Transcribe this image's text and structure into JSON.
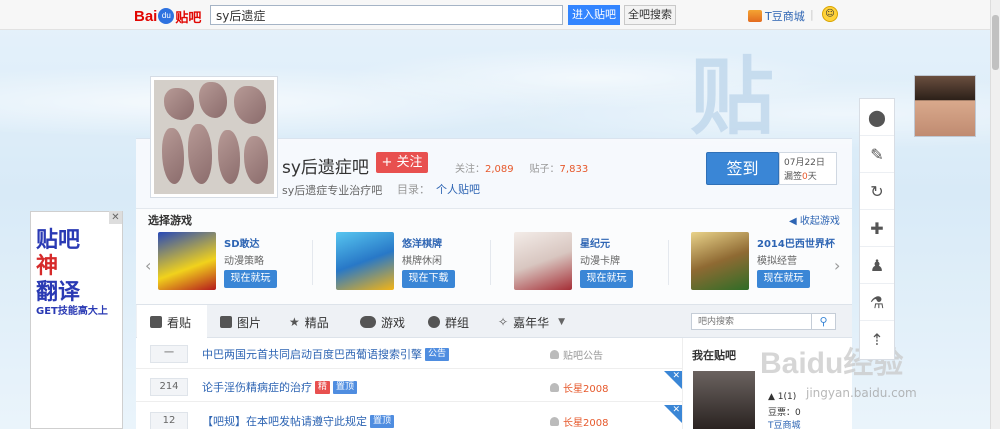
{
  "topbar": {
    "logo_bai": "Bai",
    "logo_du": "du",
    "logo_tieba": "贴吧",
    "search_value": "sy后遗症",
    "enter_button": "进入贴吧",
    "all_search_button": "全吧搜索",
    "tdou": "T豆商城"
  },
  "forum": {
    "name": "sy后遗症吧",
    "follow": "+ 关注",
    "follow_label": "关注：",
    "follow_count": "2,089",
    "posts_label": "贴子：",
    "posts_count": "7,833",
    "slogan": "sy后遗症专业治疗吧",
    "dir_label": "目录：",
    "dir_value": "个人贴吧",
    "sign_button": "签到",
    "sign_date": "07月22日",
    "sign_streak_prefix": "漏签",
    "sign_streak_num": "0",
    "sign_streak_suffix": "天"
  },
  "games": {
    "title": "选择游戏",
    "collapse": "收起游戏",
    "items": [
      {
        "name": "SD敢达",
        "sub": "动漫策略",
        "action": "现在就玩"
      },
      {
        "name": "悠洋棋牌",
        "sub": "棋牌休闲",
        "action": "现在下载"
      },
      {
        "name": "星纪元",
        "sub": "动漫卡牌",
        "action": "现在就玩"
      },
      {
        "name": "2014巴西世界杯",
        "sub": "模拟经营",
        "action": "现在就玩"
      }
    ]
  },
  "tabs": {
    "items": [
      "看贴",
      "图片",
      "精品",
      "游戏",
      "群组",
      "嘉年华"
    ],
    "search_placeholder": "吧内搜索"
  },
  "posts": [
    {
      "replies": "一",
      "title": "中巴两国元首共同启动百度巴西葡语搜索引擎",
      "tags": [
        {
          "text": "公告",
          "color": "blue"
        }
      ],
      "author": "贴吧公告"
    },
    {
      "replies": "214",
      "title": "论手淫伤精病症的治疗",
      "tags": [
        {
          "text": "精",
          "color": "red"
        },
        {
          "text": "置顶",
          "color": "blue"
        }
      ],
      "author": "长星2008"
    },
    {
      "replies": "12",
      "title": "【吧规】在本吧发帖请遵守此规定",
      "tags": [
        {
          "text": "置顶",
          "color": "blue"
        }
      ],
      "author": "长星2008"
    }
  ],
  "side": {
    "title": "我在贴吧",
    "line1": "▲ 1(1)",
    "line2": "豆票：0",
    "line3": "T豆商城"
  },
  "ad": {
    "line1": "贴吧",
    "line2": "神",
    "line3": "翻译",
    "extra": "GET技能高大上"
  },
  "watermark": {
    "main": "Baidu经验",
    "sub": "jingyan.baidu.com"
  }
}
